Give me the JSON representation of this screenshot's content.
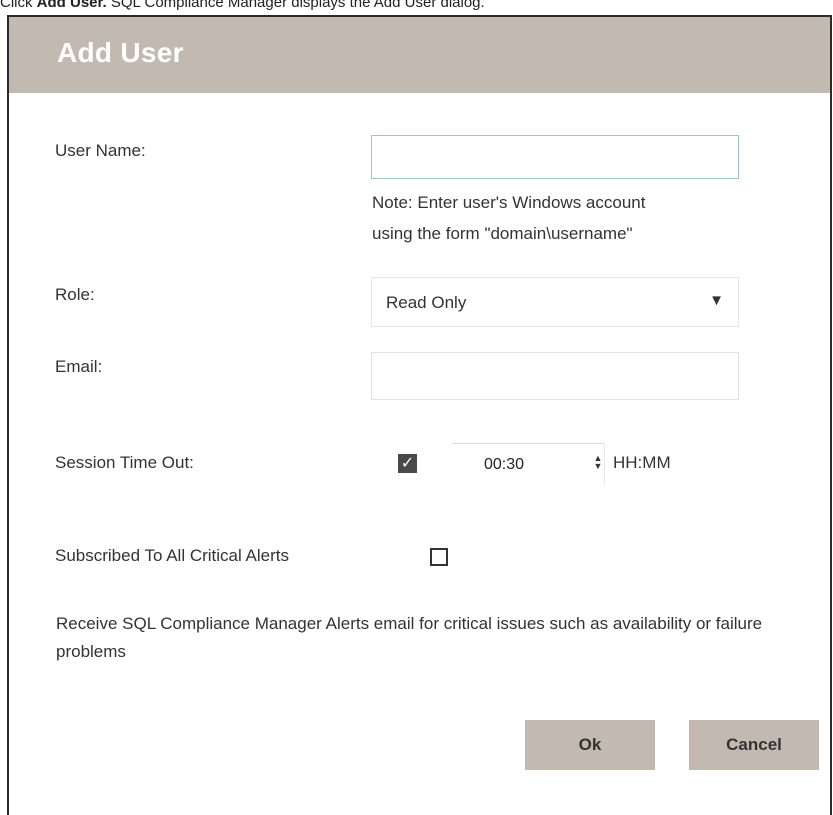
{
  "caption": {
    "prefix": "Click ",
    "bold": "Add User.",
    "suffix": " SQL Compliance Manager displays the Add User dialog."
  },
  "dialog": {
    "title": "Add User",
    "fields": {
      "user_name_label": "User Name:",
      "user_name_value": "",
      "note_line1": "Note: Enter user's Windows account",
      "note_line2": "using the form \"domain\\username\"",
      "role_label": "Role:",
      "role_value": "Read Only",
      "email_label": "Email:",
      "email_value": "",
      "session_label": "Session Time Out:",
      "session_enabled": true,
      "session_value": "00:30",
      "session_unit": "HH:MM",
      "alerts_label": "Subscribed To All Critical Alerts",
      "alerts_checked": false,
      "description": "Receive SQL Compliance Manager Alerts email for critical issues such as availability or failure problems"
    },
    "buttons": {
      "ok": "Ok",
      "cancel": "Cancel"
    }
  },
  "icons": {
    "dropdown": "caret-down-icon",
    "spinner": "spinner-arrows-icon",
    "check": "checkmark-icon"
  },
  "colors": {
    "titlebar": "#c2b9b1",
    "button": "#c2b9b1",
    "text": "#333333"
  }
}
